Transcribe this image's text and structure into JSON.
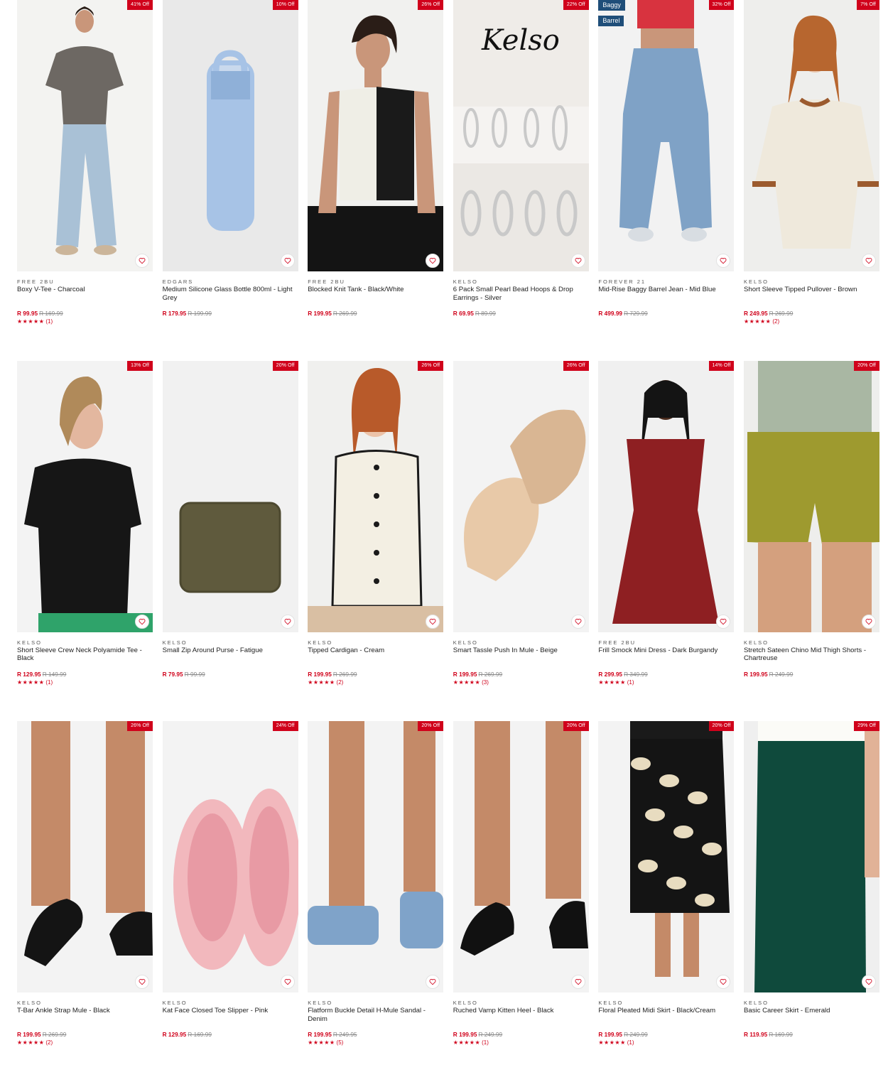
{
  "products": [
    {
      "brand": "FREE 2BU",
      "title": "Boxy V-Tee - Charcoal",
      "price": "R 99.95",
      "was": "R 169.99",
      "badge": "41% Off",
      "stars": "★★★★★",
      "count": "(1)",
      "bg": "#f3f3f1",
      "icon": "tshirt-model-icon",
      "colors": [
        "#6d6863",
        "#a9c1d6"
      ]
    },
    {
      "brand": "EDGARS",
      "title": "Medium Silicone Glass Bottle 800ml - Light Grey",
      "price": "R 179.95",
      "was": "R 199.99",
      "badge": "10% Off",
      "stars": "",
      "count": "",
      "bg": "#e9e9e9",
      "icon": "bottle-icon",
      "colors": [
        "#a7c3e6",
        "#8fb0d8"
      ]
    },
    {
      "brand": "FREE 2BU",
      "title": "Blocked Knit Tank - Black/White",
      "price": "R 199.95",
      "was": "R 269.99",
      "badge": "26% Off",
      "stars": "",
      "count": "",
      "bg": "#f1f1ef",
      "icon": "tank-model-icon",
      "colors": [
        "#1a1a1a",
        "#efeee6"
      ]
    },
    {
      "brand": "KELSO",
      "title": "6 Pack Small Pearl Bead Hoops & Drop Earrings - Silver",
      "price": "R 69.95",
      "was": "R 89.99",
      "badge": "22% Off",
      "stars": "",
      "count": "",
      "bg": "#f5f3f1",
      "icon": "earrings-icon",
      "colors": [
        "#c9c9c9",
        "#e0dcd7"
      ],
      "logo": "kelso"
    },
    {
      "brand": "FOREVER 21",
      "title": "Mid-Rise Baggy Barrel Jean - Mid Blue",
      "price": "R 499.99",
      "was": "R 729.99",
      "badge": "32% Off",
      "stars": "",
      "count": "",
      "bg": "#f2f2f2",
      "icon": "jeans-model-icon",
      "colors": [
        "#7fa2c6",
        "#d8dde2"
      ],
      "tags": [
        "Baggy",
        "Barrel"
      ]
    },
    {
      "brand": "KELSO",
      "title": "Short Sleeve Tipped Pullover - Brown",
      "price": "R 249.95",
      "was": "R 269.99",
      "badge": "7% Off",
      "stars": "★★★★★",
      "count": "(2)",
      "bg": "#eeeeec",
      "icon": "pullover-model-icon",
      "colors": [
        "#efe9dc",
        "#9b5a2e"
      ]
    },
    {
      "brand": "KELSO",
      "title": "Short Sleeve Crew Neck Polyamide Tee - Black",
      "price": "R 129.95",
      "was": "R 149.99",
      "badge": "13% Off",
      "stars": "★★★★★",
      "count": "(1)",
      "bg": "#f3f3f3",
      "icon": "tee-model-icon",
      "colors": [
        "#161616",
        "#2fa36a"
      ]
    },
    {
      "brand": "KELSO",
      "title": "Small Zip Around Purse - Fatigue",
      "price": "R 79.95",
      "was": "R 99.99",
      "badge": "20% Off",
      "stars": "",
      "count": "",
      "bg": "#f1f1f1",
      "icon": "purse-icon",
      "colors": [
        "#5f5a3d",
        "#4d4930"
      ]
    },
    {
      "brand": "KELSO",
      "title": "Tipped Cardigan - Cream",
      "price": "R 199.95",
      "was": "R 269.99",
      "badge": "26% Off",
      "stars": "★★★★★",
      "count": "(2)",
      "bg": "#f0f0ee",
      "icon": "cardigan-model-icon",
      "colors": [
        "#f3efe3",
        "#1a1a1a"
      ]
    },
    {
      "brand": "KELSO",
      "title": "Smart Tassle Push In Mule - Beige",
      "price": "R 199.95",
      "was": "R 269.99",
      "badge": "26% Off",
      "stars": "★★★★★",
      "count": "(3)",
      "bg": "#f3f3f3",
      "icon": "mule-icon",
      "colors": [
        "#e8c9a8",
        "#d9b693"
      ]
    },
    {
      "brand": "FREE 2BU",
      "title": "Frill Smock Mini Dress - Dark Burgandy",
      "price": "R 299.95",
      "was": "R 349.99",
      "badge": "14% Off",
      "stars": "★★★★★",
      "count": "(1)",
      "bg": "#f0f0f0",
      "icon": "dress-model-icon",
      "colors": [
        "#8e1f22",
        "#3a2a22"
      ]
    },
    {
      "brand": "KELSO",
      "title": "Stretch Sateen Chino Mid Thigh Shorts - Chartreuse",
      "price": "R 199.95",
      "was": "R 249.99",
      "badge": "20% Off",
      "stars": "",
      "count": "",
      "bg": "#eeeeec",
      "icon": "shorts-model-icon",
      "colors": [
        "#9e9a2f",
        "#a9b7a3"
      ]
    },
    {
      "brand": "KELSO",
      "title": "T-Bar Ankle Strap Mule - Black",
      "price": "R 199.95",
      "was": "R 269.99",
      "badge": "26% Off",
      "stars": "★★★★★",
      "count": "(2)",
      "bg": "#f3f3f3",
      "icon": "heels-icon",
      "colors": [
        "#141414",
        "#c48a68"
      ]
    },
    {
      "brand": "KELSO",
      "title": "Kat Face Closed Toe Slipper - Pink",
      "price": "R 129.95",
      "was": "R 169.99",
      "badge": "24% Off",
      "stars": "",
      "count": "",
      "bg": "#f3f3f3",
      "icon": "slipper-icon",
      "colors": [
        "#f2b8bd",
        "#e89aa4"
      ]
    },
    {
      "brand": "KELSO",
      "title": "Flatform Buckle Detail H-Mule Sandal - Denim",
      "price": "R 199.95",
      "was": "R 249.95",
      "badge": "20% Off",
      "stars": "★★★★★",
      "count": "(5)",
      "bg": "#f3f3f3",
      "icon": "sandal-icon",
      "colors": [
        "#7fa3c9",
        "#c48a68"
      ]
    },
    {
      "brand": "KELSO",
      "title": "Ruched Vamp Kitten Heel - Black",
      "price": "R 199.95",
      "was": "R 249.99",
      "badge": "20% Off",
      "stars": "★★★★★",
      "count": "(1)",
      "bg": "#f3f3f3",
      "icon": "kitten-heel-icon",
      "colors": [
        "#111111",
        "#c48a68"
      ]
    },
    {
      "brand": "KELSO",
      "title": "Floral Pleated Midi Skirt - Black/Cream",
      "price": "R 199.95",
      "was": "R 249.99",
      "badge": "20% Off",
      "stars": "★★★★★",
      "count": "(1)",
      "bg": "#f3f3f3",
      "icon": "skirt-model-icon",
      "colors": [
        "#141414",
        "#e8dcc0"
      ]
    },
    {
      "brand": "KELSO",
      "title": "Basic Career Skirt - Emerald",
      "price": "R 119.95",
      "was": "R 169.99",
      "badge": "29% Off",
      "stars": "",
      "count": "",
      "bg": "#efefef",
      "icon": "pencil-skirt-model-icon",
      "colors": [
        "#0f4a3c",
        "#c48a68"
      ]
    }
  ],
  "theme": {
    "sale": "#d0021b",
    "tag": "#1f4e79"
  }
}
